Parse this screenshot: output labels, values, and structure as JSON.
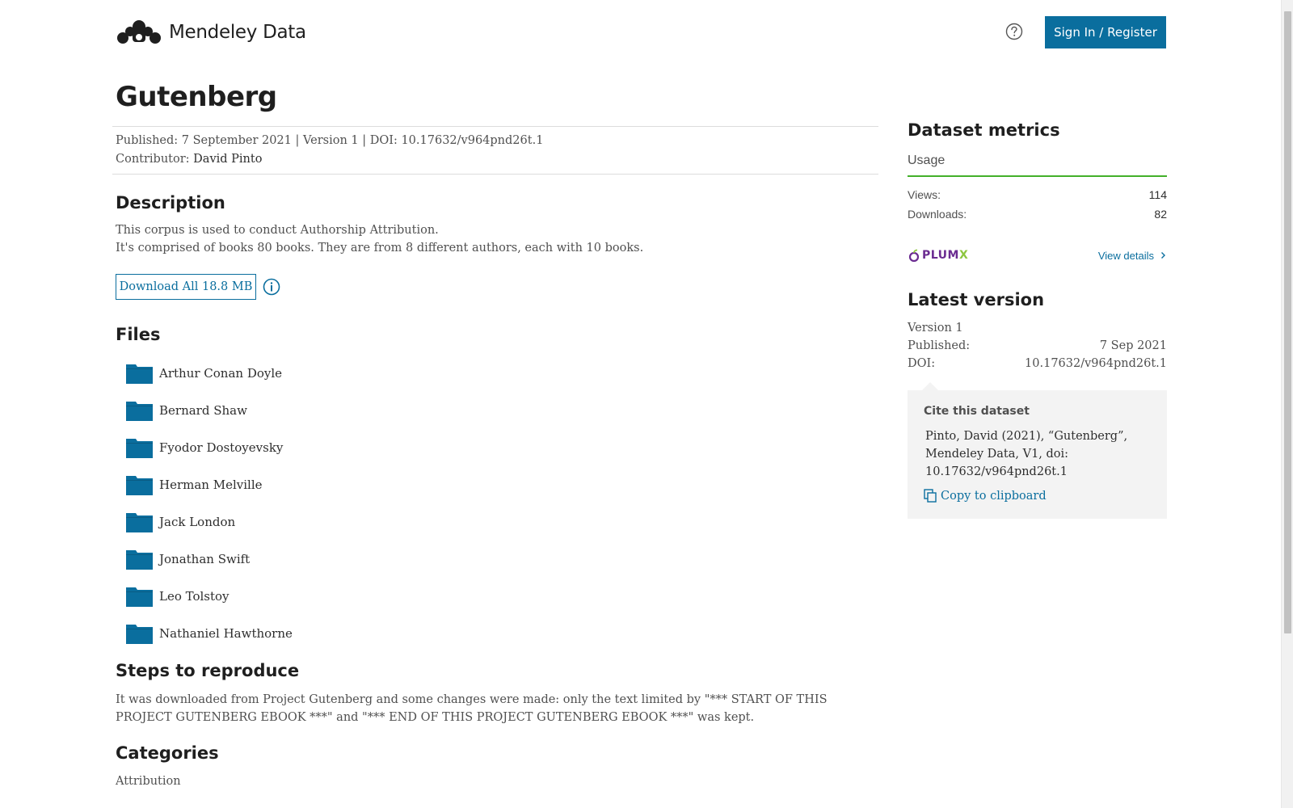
{
  "header": {
    "logo_text": "Mendeley Data",
    "help_icon": "question-circle-icon",
    "signin_label": "Sign In / Register"
  },
  "dataset": {
    "title": "Gutenberg",
    "published_line": "Published: 7 September 2021 | Version 1 | DOI: 10.17632/v964pnd26t.1",
    "contributor_label": "Contributor:",
    "contributor_name": "David Pinto"
  },
  "description": {
    "heading": "Description",
    "line1": "This corpus is used to conduct Authorship Attribution.",
    "line2": "It's comprised of books 80 books. They are from 8 different authors, each with 10 books."
  },
  "download": {
    "label": "Download All 18.8 MB",
    "info_icon": "info-circle-icon"
  },
  "files": {
    "heading": "Files",
    "items": [
      {
        "name": "Arthur Conan Doyle",
        "icon": "folder-icon"
      },
      {
        "name": "Bernard Shaw",
        "icon": "folder-icon"
      },
      {
        "name": "Fyodor Dostoyevsky",
        "icon": "folder-icon"
      },
      {
        "name": "Herman Melville",
        "icon": "folder-icon"
      },
      {
        "name": "Jack London",
        "icon": "folder-icon"
      },
      {
        "name": "Jonathan Swift",
        "icon": "folder-icon"
      },
      {
        "name": "Leo Tolstoy",
        "icon": "folder-icon"
      },
      {
        "name": "Nathaniel Hawthorne",
        "icon": "folder-icon"
      }
    ]
  },
  "steps": {
    "heading": "Steps to reproduce",
    "text": "It was downloaded from Project Gutenberg and some changes were made: only the text limited by \"*** START OF THIS PROJECT GUTENBERG EBOOK ***\" and \"*** END OF THIS PROJECT GUTENBERG EBOOK ***\" was kept."
  },
  "categories": {
    "heading": "Categories",
    "items": [
      "Attribution"
    ]
  },
  "metrics": {
    "heading": "Dataset metrics",
    "usage_label": "Usage",
    "views_label": "Views:",
    "views_value": "114",
    "downloads_label": "Downloads:",
    "downloads_value": "82",
    "plumx_text": "PLUM",
    "plumx_x": "X",
    "view_details": "View details"
  },
  "latest": {
    "heading": "Latest version",
    "version": "Version 1",
    "published_label": "Published:",
    "published_value": "7 Sep 2021",
    "doi_label": "DOI:",
    "doi_value": "10.17632/v964pnd26t.1"
  },
  "cite": {
    "heading": "Cite this dataset",
    "line1": "Pinto, David (2021), “Gutenberg”,",
    "line2": "Mendeley Data, V1, doi:",
    "line3": "10.17632/v964pnd26t.1",
    "copy_label": "Copy to clipboard"
  },
  "colors": {
    "accent": "#0a6e9e",
    "usage_bar": "#43b02a",
    "plumx_purple": "#6b2c91"
  }
}
